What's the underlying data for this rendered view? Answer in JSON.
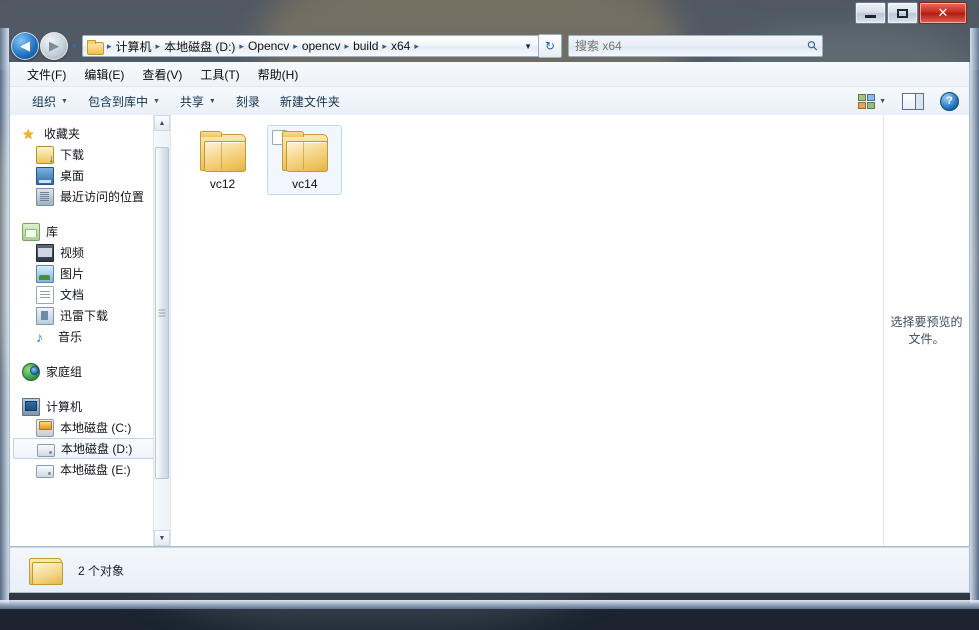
{
  "window": {
    "caption_buttons": [
      {
        "name": "minimize",
        "glyph": "—"
      },
      {
        "name": "maximize",
        "glyph": "▢"
      },
      {
        "name": "close",
        "glyph": "✕"
      }
    ]
  },
  "addressbar": {
    "back_label": "◀",
    "forward_label": "▶",
    "recent_caret": "▼",
    "breadcrumb": [
      {
        "label": "计算机"
      },
      {
        "label": "本地磁盘 (D:)"
      },
      {
        "label": "Opencv"
      },
      {
        "label": "opencv"
      },
      {
        "label": "build"
      },
      {
        "label": "x64"
      }
    ],
    "separator": "▸",
    "dropdown_caret": "▼",
    "refresh_glyph": "↻"
  },
  "search": {
    "placeholder": "搜索 x64",
    "icon": "search-icon",
    "value": ""
  },
  "menubar": {
    "items": [
      {
        "label": "文件(F)"
      },
      {
        "label": "编辑(E)"
      },
      {
        "label": "查看(V)"
      },
      {
        "label": "工具(T)"
      },
      {
        "label": "帮助(H)"
      }
    ]
  },
  "commandbar": {
    "items": [
      {
        "label": "组织",
        "caret": "▼"
      },
      {
        "label": "包含到库中",
        "caret": "▼"
      },
      {
        "label": "共享",
        "caret": "▼"
      },
      {
        "label": "刻录",
        "caret": ""
      },
      {
        "label": "新建文件夹",
        "caret": ""
      }
    ],
    "view_caret": "▼",
    "help_glyph": "?"
  },
  "navpane": {
    "groups": [
      {
        "header": {
          "label": "收藏夹",
          "icon": "star-icon"
        },
        "items": [
          {
            "label": "下载",
            "icon": "download-icon"
          },
          {
            "label": "桌面",
            "icon": "desktop-icon"
          },
          {
            "label": "最近访问的位置",
            "icon": "recent-places-icon"
          }
        ]
      },
      {
        "header": {
          "label": "库",
          "icon": "library-icon"
        },
        "items": [
          {
            "label": "视频",
            "icon": "video-icon"
          },
          {
            "label": "图片",
            "icon": "picture-icon"
          },
          {
            "label": "文档",
            "icon": "document-icon"
          },
          {
            "label": "迅雷下载",
            "icon": "thunder-download-icon"
          },
          {
            "label": "音乐",
            "icon": "music-icon"
          }
        ]
      },
      {
        "header": {
          "label": "家庭组",
          "icon": "homegroup-icon"
        },
        "items": []
      },
      {
        "header": {
          "label": "计算机",
          "icon": "computer-icon"
        },
        "items": [
          {
            "label": "本地磁盘 (C:)",
            "icon": "system-drive-icon",
            "selected": false
          },
          {
            "label": "本地磁盘 (D:)",
            "icon": "drive-icon",
            "selected": true
          },
          {
            "label": "本地磁盘 (E:)",
            "icon": "drive-icon",
            "selected": false
          }
        ]
      }
    ],
    "scrollbar": {
      "up": "▲",
      "down": "▼"
    }
  },
  "filelist": {
    "items": [
      {
        "label": "vc12",
        "icon": "folder-icon",
        "hovered": false
      },
      {
        "label": "vc14",
        "icon": "folder-icon",
        "hovered": true
      }
    ]
  },
  "preview": {
    "message": "选择要预览的文件。"
  },
  "statusbar": {
    "icon": "folder-icon",
    "text": "2 个对象"
  },
  "colors": {
    "accent": "#1d72bd",
    "folder": "#edc054",
    "close_button": "#c7281a",
    "selection": "#bdd3e8"
  }
}
